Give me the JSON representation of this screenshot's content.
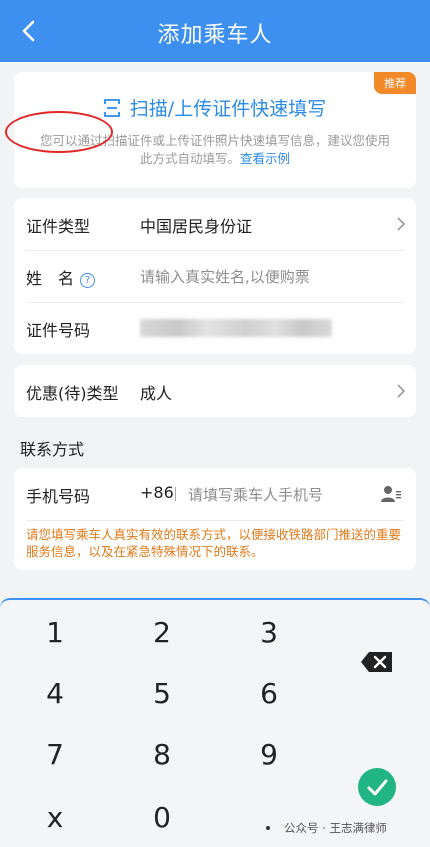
{
  "header": {
    "title": "添加乘车人"
  },
  "scan": {
    "badge": "推荐",
    "title": "扫描/上传证件快速填写",
    "desc": "您可以通过扫描证件或上传证件照片快速填写信息，建议您使用此方式自动填写。",
    "link": "查看示例"
  },
  "form": {
    "id_type": {
      "label": "证件类型",
      "value": "中国居民身份证"
    },
    "name": {
      "label": "姓　名",
      "placeholder": "请输入真实姓名,以便购票"
    },
    "id_number": {
      "label": "证件号码"
    },
    "discount": {
      "label": "优惠(待)类型",
      "value": "成人"
    }
  },
  "contact": {
    "section_title": "联系方式",
    "phone_label": "手机号码",
    "prefix": "+86",
    "phone_placeholder": "请填写乘车人手机号",
    "notice": "请您填写乘车人真实有效的联系方式，以便接收铁路部门推送的重要服务信息，以及在紧急特殊情况下的联系。"
  },
  "keyboard": {
    "keys": [
      "1",
      "2",
      "3",
      "4",
      "5",
      "6",
      "7",
      "8",
      "9",
      "x",
      "0"
    ]
  },
  "watermark": "公众号 · 王志满律师",
  "colors": {
    "primary": "#3d8ff0",
    "link": "#2b8be6",
    "badge": "#f28a2a",
    "notice": "#e07a1a",
    "confirm": "#21b583",
    "annotation": "#e0292b"
  }
}
